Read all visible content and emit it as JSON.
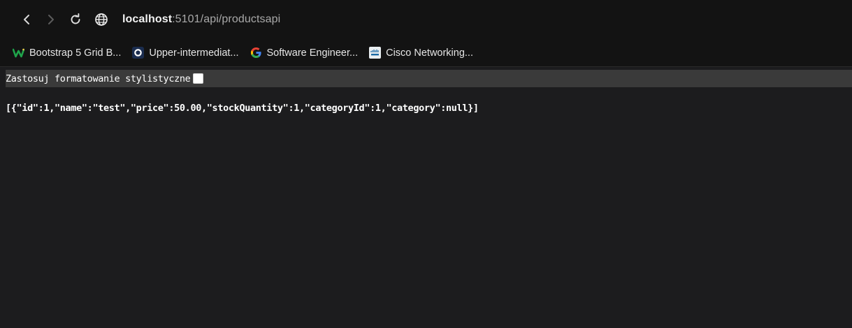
{
  "browser": {
    "back_icon": "chevron-left-icon",
    "forward_icon": "chevron-right-icon",
    "reload_icon": "reload-icon",
    "site_info_icon": "globe-icon",
    "url_host": "localhost",
    "url_path": ":5101/api/productsapi"
  },
  "bookmarks": [
    {
      "label": "Bootstrap 5 Grid B...",
      "icon": "w-logo-icon",
      "color": "#1fa34a"
    },
    {
      "label": "Upper-intermediat...",
      "icon": "circle-o-icon",
      "color": "#2b5cb8"
    },
    {
      "label": "Software Engineer...",
      "icon": "google-g-icon",
      "color": "#4285f4"
    },
    {
      "label": "Cisco Networking...",
      "icon": "cisco-icon",
      "color": "#cfd8dc"
    }
  ],
  "pretty_print": {
    "label": "Zastosuj formatowanie stylistyczne"
  },
  "content": {
    "json_text": "[{\"id\":1,\"name\":\"test\",\"price\":50.00,\"stockQuantity\":1,\"categoryId\":1,\"category\":null}]"
  },
  "records": [
    {
      "id": 1,
      "name": "test",
      "price": "50.00",
      "stockQuantity": 1,
      "categoryId": 1,
      "category": null
    }
  ]
}
